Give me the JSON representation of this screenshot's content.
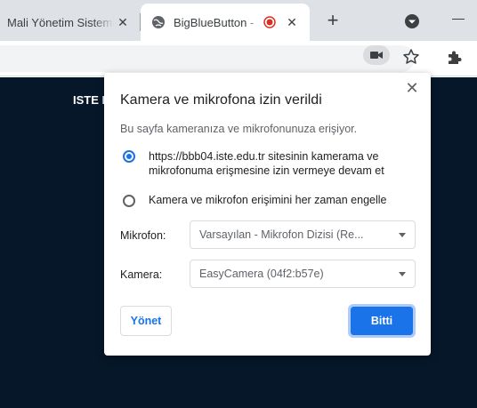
{
  "tabs": [
    {
      "title": "Mali Yönetim Sistemi",
      "close_glyph": "✕",
      "active": false
    },
    {
      "title": "BigBlueButton - ",
      "close_glyph": "✕",
      "active": true
    }
  ],
  "new_tab_glyph": "+",
  "toolbar": {
    "icons": [
      "camera-in-use-icon",
      "star-icon",
      "puzzle-extension-icon"
    ]
  },
  "page": {
    "text": "ISTE B"
  },
  "popup": {
    "close_glyph": "✕",
    "title": "Kamera ve mikrofona izin verildi",
    "description": "Bu sayfa kameranıza ve mikrofonunuza erişiyor.",
    "allow_option": "https://bbb04.iste.edu.tr sitesinin kamerama ve\nmikrofonuma erişmesine izin vermeye devam et",
    "block_option": "Kamera ve mikrofon erişimini her zaman engelle",
    "selected_option": "allow",
    "microphone_label": "Mikrofon:",
    "microphone_value": "Varsayılan - Mikrofon Dizisi (Re...",
    "camera_label": "Kamera:",
    "camera_value": "EasyCamera (04f2:b57e)",
    "manage_button": "Yönet",
    "done_button": "Bitti"
  },
  "colors": {
    "accent": "#1a73e8",
    "page_background": "#06172a",
    "recording": "#d93025"
  }
}
